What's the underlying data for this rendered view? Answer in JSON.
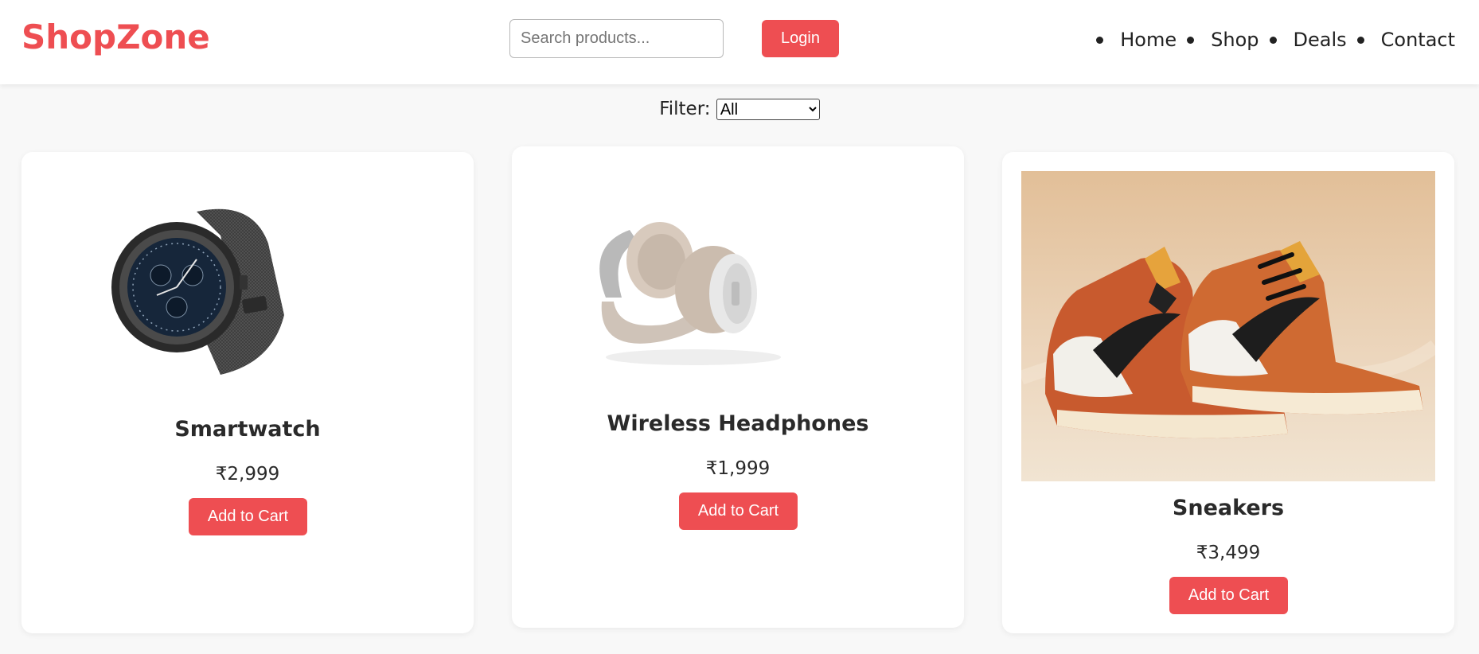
{
  "header": {
    "brand": "ShopZone",
    "search_placeholder": "Search products...",
    "login_label": "Login",
    "nav": [
      "Home",
      "Shop",
      "Deals",
      "Contact"
    ]
  },
  "filter": {
    "label": "Filter:",
    "selected": "All"
  },
  "products": [
    {
      "name": "Smartwatch",
      "price": "₹2,999",
      "button": "Add to Cart",
      "image": "smartwatch-image"
    },
    {
      "name": "Wireless Headphones",
      "price": "₹1,999",
      "button": "Add to Cart",
      "image": "headphones-image"
    },
    {
      "name": "Sneakers",
      "price": "₹3,499",
      "button": "Add to Cart",
      "image": "sneakers-image"
    }
  ],
  "colors": {
    "accent": "#ee4e52",
    "background": "#f8f8f8"
  }
}
